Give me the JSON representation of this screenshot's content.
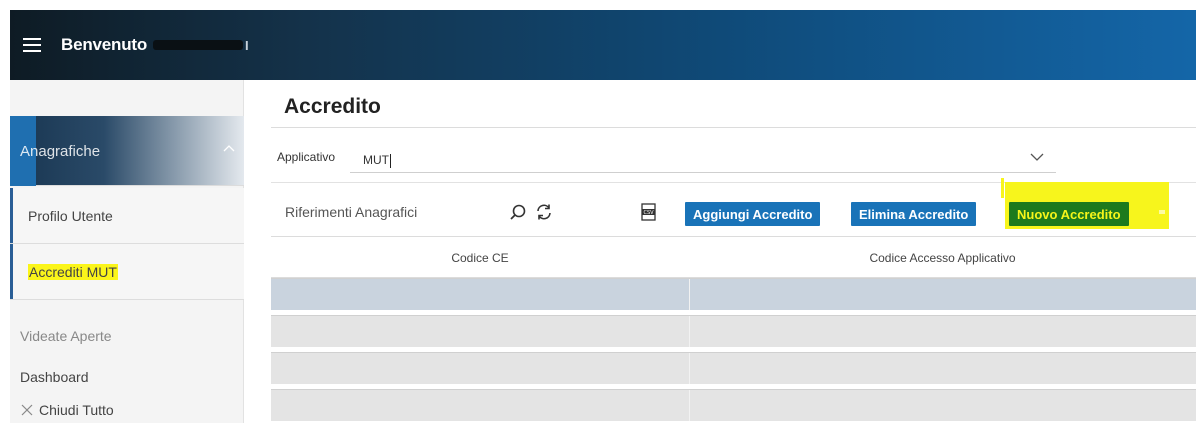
{
  "header": {
    "welcome_label": "Benvenuto",
    "welcome_tail": "I"
  },
  "sidebar": {
    "group_label": "Anagrafiche",
    "items": [
      {
        "label": "Profilo Utente"
      },
      {
        "label": "Accrediti MUT"
      }
    ],
    "open_views_label": "Videate Aperte",
    "dashboard_label": "Dashboard",
    "close_all_label": "Chiudi Tutto"
  },
  "main": {
    "title": "Accredito",
    "applicativo_label": "Applicativo",
    "applicativo_value": "MUT",
    "toolbar": {
      "filter_label": "Riferimenti Anagrafici",
      "add_button": "Aggiungi Accredito",
      "delete_button": "Elimina Accredito",
      "new_button": "Nuovo Accredito"
    },
    "table": {
      "columns": [
        "Codice CE",
        "Codice Accesso Applicativo"
      ],
      "rows": [
        {
          "selected": true,
          "cells": [
            "",
            ""
          ]
        },
        {
          "selected": false,
          "cells": [
            "",
            ""
          ]
        },
        {
          "selected": false,
          "cells": [
            "",
            ""
          ]
        },
        {
          "selected": false,
          "cells": [
            "",
            ""
          ]
        }
      ]
    }
  },
  "colors": {
    "header_dark": "#0e1b24",
    "header_blue": "#1466a8",
    "button_blue": "#1973b8",
    "highlight_yellow": "#fbf51a",
    "new_button_green": "#1d7a1d",
    "selected_row": "#c9d3de"
  },
  "icons": [
    "menu-icon",
    "chevron-up-icon",
    "chevron-down-icon",
    "search-icon",
    "refresh-icon",
    "csv-export-icon",
    "close-icon"
  ]
}
